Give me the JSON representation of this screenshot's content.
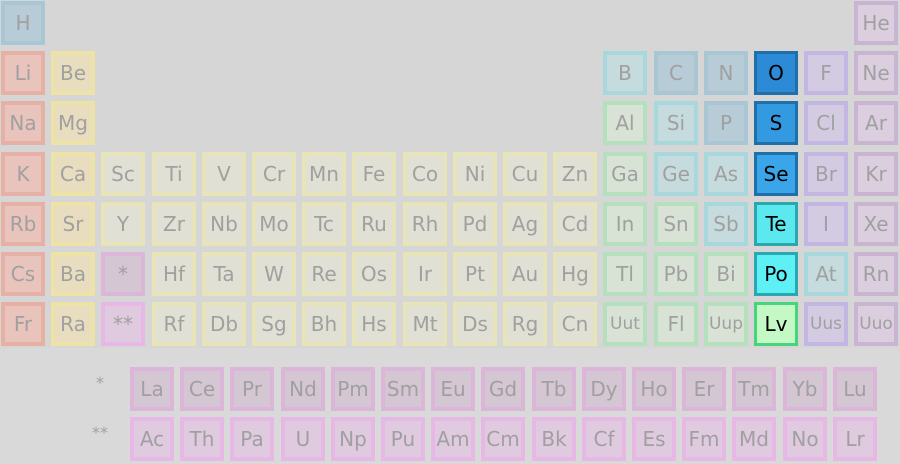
{
  "categories": {
    "alkali": {
      "fill": "#e8c4bc",
      "border": "#e7b0a4"
    },
    "alkaline": {
      "fill": "#e9ddbf",
      "border": "#ede3a7"
    },
    "transition": {
      "fill": "#e0e0d4",
      "border": "#e7e4b9"
    },
    "post": {
      "fill": "#d8e2d5",
      "border": "#b5e0bd"
    },
    "metalloid": {
      "fill": "#c5dbde",
      "border": "#a9d8dc"
    },
    "nonmetal": {
      "fill": "#b7ccd7",
      "border": "#a9c6d4"
    },
    "halogen": {
      "fill": "#d3cbe2",
      "border": "#c4b6e3"
    },
    "noble": {
      "fill": "#dbcfdf",
      "border": "#c9b5d2"
    },
    "lanthanide": {
      "fill": "#d5c6d3",
      "border": "#dcb6d8"
    },
    "actinide": {
      "fill": "#dfcadf",
      "border": "#e7b7e6"
    },
    "unknown": {
      "fill": "#dcdcdc",
      "border": "#cfcfcf"
    }
  },
  "elements": [
    {
      "s": "H",
      "c": "nonmetal",
      "r": 0,
      "col": 0
    },
    {
      "s": "He",
      "c": "noble",
      "r": 0,
      "col": 17
    },
    {
      "s": "Li",
      "c": "alkali",
      "r": 1,
      "col": 0
    },
    {
      "s": "Be",
      "c": "alkaline",
      "r": 1,
      "col": 1
    },
    {
      "s": "B",
      "c": "metalloid",
      "r": 1,
      "col": 12
    },
    {
      "s": "C",
      "c": "nonmetal",
      "r": 1,
      "col": 13
    },
    {
      "s": "N",
      "c": "nonmetal",
      "r": 1,
      "col": 14
    },
    {
      "s": "O",
      "c": "focus",
      "r": 1,
      "col": 15,
      "fill": "#2c8ad6",
      "border": "#1f6fa8"
    },
    {
      "s": "F",
      "c": "halogen",
      "r": 1,
      "col": 16
    },
    {
      "s": "Ne",
      "c": "noble",
      "r": 1,
      "col": 17
    },
    {
      "s": "Na",
      "c": "alkali",
      "r": 2,
      "col": 0
    },
    {
      "s": "Mg",
      "c": "alkaline",
      "r": 2,
      "col": 1
    },
    {
      "s": "Al",
      "c": "post",
      "r": 2,
      "col": 12
    },
    {
      "s": "Si",
      "c": "metalloid",
      "r": 2,
      "col": 13
    },
    {
      "s": "P",
      "c": "nonmetal",
      "r": 2,
      "col": 14
    },
    {
      "s": "S",
      "c": "focus",
      "r": 2,
      "col": 15,
      "fill": "#3399e0",
      "border": "#1f6fa8"
    },
    {
      "s": "Cl",
      "c": "halogen",
      "r": 2,
      "col": 16
    },
    {
      "s": "Ar",
      "c": "noble",
      "r": 2,
      "col": 17
    },
    {
      "s": "K",
      "c": "alkali",
      "r": 3,
      "col": 0
    },
    {
      "s": "Ca",
      "c": "alkaline",
      "r": 3,
      "col": 1
    },
    {
      "s": "Sc",
      "c": "transition",
      "r": 3,
      "col": 2
    },
    {
      "s": "Ti",
      "c": "transition",
      "r": 3,
      "col": 3
    },
    {
      "s": "V",
      "c": "transition",
      "r": 3,
      "col": 4
    },
    {
      "s": "Cr",
      "c": "transition",
      "r": 3,
      "col": 5
    },
    {
      "s": "Mn",
      "c": "transition",
      "r": 3,
      "col": 6
    },
    {
      "s": "Fe",
      "c": "transition",
      "r": 3,
      "col": 7
    },
    {
      "s": "Co",
      "c": "transition",
      "r": 3,
      "col": 8
    },
    {
      "s": "Ni",
      "c": "transition",
      "r": 3,
      "col": 9
    },
    {
      "s": "Cu",
      "c": "transition",
      "r": 3,
      "col": 10
    },
    {
      "s": "Zn",
      "c": "transition",
      "r": 3,
      "col": 11
    },
    {
      "s": "Ga",
      "c": "post",
      "r": 3,
      "col": 12
    },
    {
      "s": "Ge",
      "c": "metalloid",
      "r": 3,
      "col": 13
    },
    {
      "s": "As",
      "c": "metalloid",
      "r": 3,
      "col": 14
    },
    {
      "s": "Se",
      "c": "focus",
      "r": 3,
      "col": 15,
      "fill": "#3aa5e8",
      "border": "#1f6fa8"
    },
    {
      "s": "Br",
      "c": "halogen",
      "r": 3,
      "col": 16
    },
    {
      "s": "Kr",
      "c": "noble",
      "r": 3,
      "col": 17
    },
    {
      "s": "Rb",
      "c": "alkali",
      "r": 4,
      "col": 0
    },
    {
      "s": "Sr",
      "c": "alkaline",
      "r": 4,
      "col": 1
    },
    {
      "s": "Y",
      "c": "transition",
      "r": 4,
      "col": 2
    },
    {
      "s": "Zr",
      "c": "transition",
      "r": 4,
      "col": 3
    },
    {
      "s": "Nb",
      "c": "transition",
      "r": 4,
      "col": 4
    },
    {
      "s": "Mo",
      "c": "transition",
      "r": 4,
      "col": 5
    },
    {
      "s": "Tc",
      "c": "transition",
      "r": 4,
      "col": 6
    },
    {
      "s": "Ru",
      "c": "transition",
      "r": 4,
      "col": 7
    },
    {
      "s": "Rh",
      "c": "transition",
      "r": 4,
      "col": 8
    },
    {
      "s": "Pd",
      "c": "transition",
      "r": 4,
      "col": 9
    },
    {
      "s": "Ag",
      "c": "transition",
      "r": 4,
      "col": 10
    },
    {
      "s": "Cd",
      "c": "transition",
      "r": 4,
      "col": 11
    },
    {
      "s": "In",
      "c": "post",
      "r": 4,
      "col": 12
    },
    {
      "s": "Sn",
      "c": "post",
      "r": 4,
      "col": 13
    },
    {
      "s": "Sb",
      "c": "metalloid",
      "r": 4,
      "col": 14
    },
    {
      "s": "Te",
      "c": "focus",
      "r": 4,
      "col": 15,
      "fill": "#5be8ee",
      "border": "#2aa8b0"
    },
    {
      "s": "I",
      "c": "halogen",
      "r": 4,
      "col": 16
    },
    {
      "s": "Xe",
      "c": "noble",
      "r": 4,
      "col": 17
    },
    {
      "s": "Cs",
      "c": "alkali",
      "r": 5,
      "col": 0
    },
    {
      "s": "Ba",
      "c": "alkaline",
      "r": 5,
      "col": 1
    },
    {
      "s": "*",
      "c": "lanthanide",
      "r": 5,
      "col": 2
    },
    {
      "s": "Hf",
      "c": "transition",
      "r": 5,
      "col": 3
    },
    {
      "s": "Ta",
      "c": "transition",
      "r": 5,
      "col": 4
    },
    {
      "s": "W",
      "c": "transition",
      "r": 5,
      "col": 5
    },
    {
      "s": "Re",
      "c": "transition",
      "r": 5,
      "col": 6
    },
    {
      "s": "Os",
      "c": "transition",
      "r": 5,
      "col": 7
    },
    {
      "s": "Ir",
      "c": "transition",
      "r": 5,
      "col": 8
    },
    {
      "s": "Pt",
      "c": "transition",
      "r": 5,
      "col": 9
    },
    {
      "s": "Au",
      "c": "transition",
      "r": 5,
      "col": 10
    },
    {
      "s": "Hg",
      "c": "transition",
      "r": 5,
      "col": 11
    },
    {
      "s": "Tl",
      "c": "post",
      "r": 5,
      "col": 12
    },
    {
      "s": "Pb",
      "c": "post",
      "r": 5,
      "col": 13
    },
    {
      "s": "Bi",
      "c": "post",
      "r": 5,
      "col": 14
    },
    {
      "s": "Po",
      "c": "focus",
      "r": 5,
      "col": 15,
      "fill": "#5df0f4",
      "border": "#2aa8b0"
    },
    {
      "s": "At",
      "c": "metalloid",
      "r": 5,
      "col": 16
    },
    {
      "s": "Rn",
      "c": "noble",
      "r": 5,
      "col": 17
    },
    {
      "s": "Fr",
      "c": "alkali",
      "r": 6,
      "col": 0
    },
    {
      "s": "Ra",
      "c": "alkaline",
      "r": 6,
      "col": 1
    },
    {
      "s": "**",
      "c": "actinide",
      "r": 6,
      "col": 2
    },
    {
      "s": "Rf",
      "c": "transition",
      "r": 6,
      "col": 3
    },
    {
      "s": "Db",
      "c": "transition",
      "r": 6,
      "col": 4
    },
    {
      "s": "Sg",
      "c": "transition",
      "r": 6,
      "col": 5
    },
    {
      "s": "Bh",
      "c": "transition",
      "r": 6,
      "col": 6
    },
    {
      "s": "Hs",
      "c": "transition",
      "r": 6,
      "col": 7
    },
    {
      "s": "Mt",
      "c": "transition",
      "r": 6,
      "col": 8
    },
    {
      "s": "Ds",
      "c": "transition",
      "r": 6,
      "col": 9
    },
    {
      "s": "Rg",
      "c": "transition",
      "r": 6,
      "col": 10
    },
    {
      "s": "Cn",
      "c": "transition",
      "r": 6,
      "col": 11
    },
    {
      "s": "Uut",
      "c": "post",
      "r": 6,
      "col": 12
    },
    {
      "s": "Fl",
      "c": "post",
      "r": 6,
      "col": 13
    },
    {
      "s": "Uup",
      "c": "post",
      "r": 6,
      "col": 14
    },
    {
      "s": "Lv",
      "c": "focus",
      "r": 6,
      "col": 15,
      "fill": "#c4f8c4",
      "border": "#48d47a"
    },
    {
      "s": "Uus",
      "c": "halogen",
      "r": 6,
      "col": 16
    },
    {
      "s": "Uuo",
      "c": "noble",
      "r": 6,
      "col": 17
    }
  ],
  "f_block_markers": [
    "*",
    "**"
  ],
  "lanthanides": [
    "La",
    "Ce",
    "Pr",
    "Nd",
    "Pm",
    "Sm",
    "Eu",
    "Gd",
    "Tb",
    "Dy",
    "Ho",
    "Er",
    "Tm",
    "Yb",
    "Lu"
  ],
  "actinides": [
    "Ac",
    "Th",
    "Pa",
    "U",
    "Np",
    "Pu",
    "Am",
    "Cm",
    "Bk",
    "Cf",
    "Es",
    "Fm",
    "Md",
    "No",
    "Lr"
  ]
}
